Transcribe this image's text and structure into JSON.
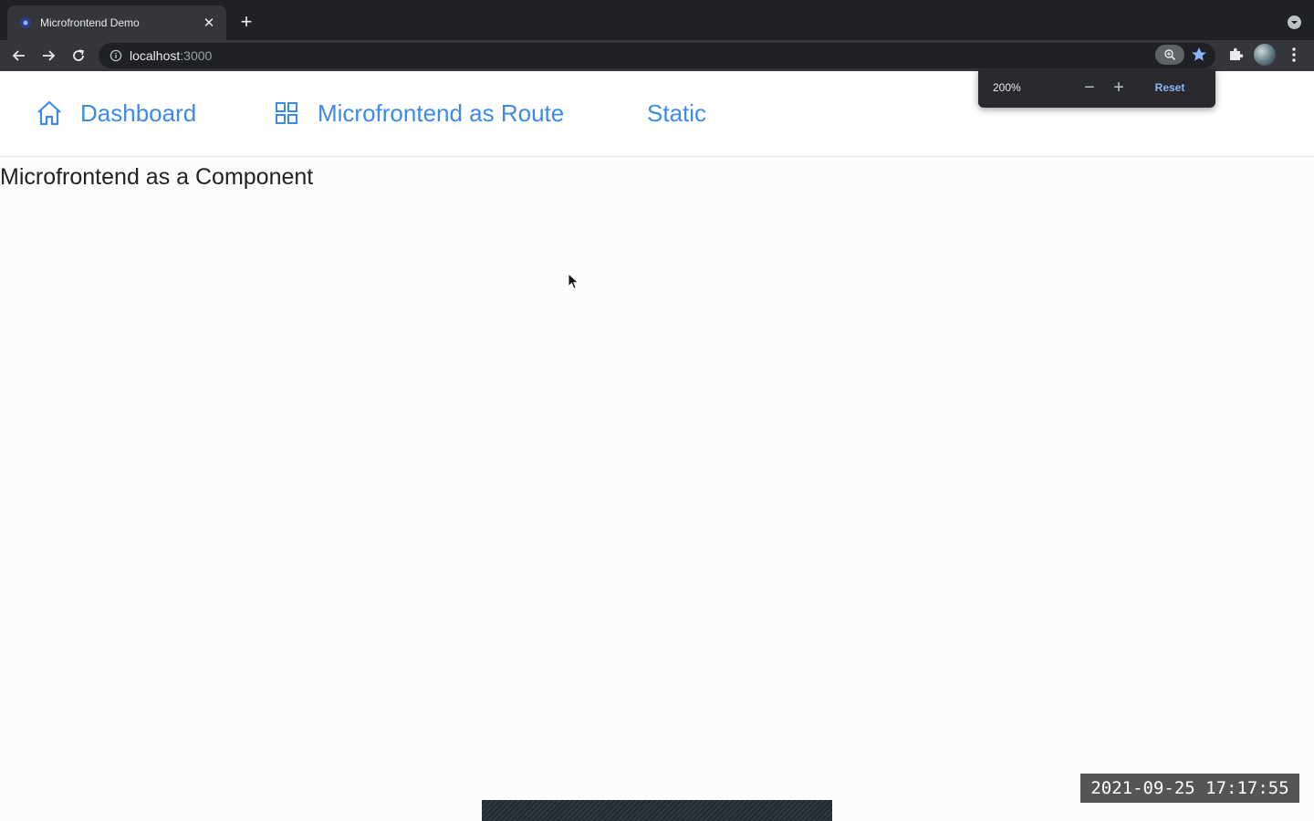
{
  "browser": {
    "tab": {
      "title": "Microfrontend Demo"
    },
    "address_bar": {
      "host": "localhost",
      "port": ":3000"
    },
    "zoom_popup": {
      "level": "200%",
      "decrease": "−",
      "increase": "+",
      "reset_label": "Reset"
    }
  },
  "page": {
    "nav": {
      "items": [
        {
          "label": "Dashboard",
          "icon": "home-icon"
        },
        {
          "label": "Microfrontend as Route",
          "icon": "grid-icon"
        },
        {
          "label": "Static"
        }
      ]
    },
    "heading": "Microfrontend as a Component"
  },
  "overlay": {
    "timestamp": "2021-09-25 17:17:55"
  },
  "colors": {
    "link": "#3e8ae6",
    "chrome_dark": "#202124",
    "chrome_toolbar": "#35363a",
    "accent_blue": "#8ab4f8"
  }
}
